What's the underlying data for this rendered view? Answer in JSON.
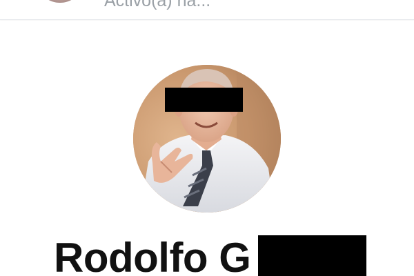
{
  "header": {
    "status_text": "Activo(a) ha..."
  },
  "profile": {
    "name": "Rodolfo G"
  },
  "icons": {
    "header_avatar": "avatar",
    "profile_avatar": "avatar-photo"
  }
}
